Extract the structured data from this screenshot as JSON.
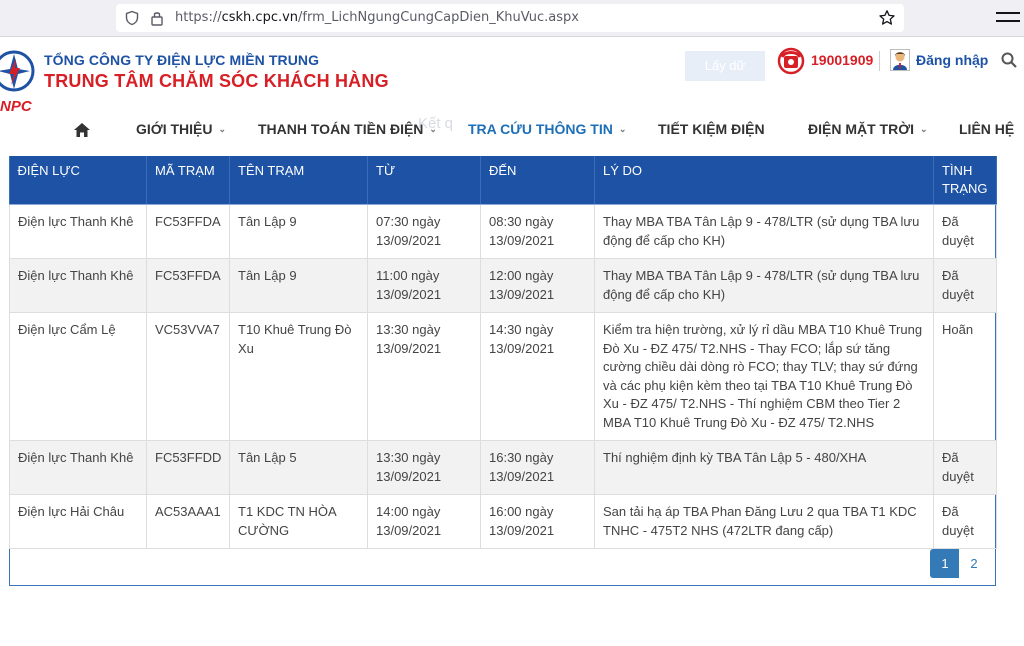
{
  "browser": {
    "url_prefix": "https://",
    "url_domain": "cskh.cpc.vn",
    "url_path": "/frm_LichNgungCungCapDien_KhuVuc.aspx"
  },
  "header": {
    "logo_text": "NPC",
    "company_line1": "TỔNG CÔNG TY ĐIỆN LỰC MIỀN TRUNG",
    "company_line2": "TRUNG TÂM CHĂM SÓC KHÁCH HÀNG",
    "ghost_button": "Lấy dữ",
    "hotline": "19001909",
    "login": "Đăng nhập",
    "ghost_text": "Kết q",
    "colors": {
      "brand_blue": "#1d52a5",
      "brand_red": "#d71f26"
    }
  },
  "nav": {
    "items": [
      {
        "label": "GIỚI THIỆU",
        "has_caret": true
      },
      {
        "label": "THANH TOÁN TIỀN ĐIỆN",
        "has_caret": true
      },
      {
        "label": "TRA CỨU THÔNG TIN",
        "has_caret": true,
        "active": true
      },
      {
        "label": "TIẾT KIỆM ĐIỆN",
        "has_caret": false
      },
      {
        "label": "ĐIỆN MẶT TRỜI",
        "has_caret": true
      },
      {
        "label": "LIÊN HỆ",
        "has_caret": false
      }
    ]
  },
  "table": {
    "headers": [
      "ĐIỆN LỰC",
      "MÃ TRẠM",
      "TÊN TRẠM",
      "TỪ",
      "ĐẾN",
      "LÝ DO",
      "TÌNH TRẠNG"
    ],
    "rows": [
      [
        "Điện lực Thanh Khê",
        "FC53FFDA",
        "Tân Lập 9",
        "07:30 ngày 13/09/2021",
        "08:30 ngày 13/09/2021",
        "Thay MBA TBA Tân Lập 9 - 478/LTR (sử dụng TBA lưu động để cấp cho KH)",
        "Đã duyệt"
      ],
      [
        "Điện lực Thanh Khê",
        "FC53FFDA",
        "Tân Lập 9",
        "11:00 ngày 13/09/2021",
        "12:00 ngày 13/09/2021",
        "Thay MBA TBA Tân Lập 9 - 478/LTR (sử dụng TBA lưu động để cấp cho KH)",
        "Đã duyệt"
      ],
      [
        "Điện lực Cẩm Lệ",
        "VC53VVA7",
        "T10 Khuê Trung Đò Xu",
        "13:30 ngày 13/09/2021",
        "14:30 ngày 13/09/2021",
        "Kiểm tra hiện trường, xử lý rỉ dầu MBA T10 Khuê Trung Đò Xu - ĐZ 475/ T2.NHS - Thay FCO; lắp sứ tăng cường chiều dài dòng rò FCO; thay TLV; thay sứ đứng và các phụ kiện kèm theo tại TBA T10 Khuê Trung Đò Xu - ĐZ 475/ T2.NHS - Thí nghiệm CBM theo Tier 2 MBA T10 Khuê Trung Đò Xu - ĐZ 475/ T2.NHS",
        "Hoãn"
      ],
      [
        "Điện lực Thanh Khê",
        "FC53FFDD",
        "Tân Lập 5",
        "13:30 ngày 13/09/2021",
        "16:30 ngày 13/09/2021",
        "Thí nghiệm định kỳ TBA Tân Lập 5 - 480/XHA",
        "Đã duyệt"
      ],
      [
        "Điện lực Hải Châu",
        "AC53AAA1",
        "T1 KDC TN HÒA CƯỜNG",
        "14:00 ngày 13/09/2021",
        "16:00 ngày 13/09/2021",
        "San tải hạ áp TBA Phan Đăng Lưu 2 qua TBA T1 KDC TNHC - 475T2 NHS (472LTR đang cấp)",
        "Đã duyệt"
      ]
    ]
  },
  "pager": {
    "current": "1",
    "other": "2"
  }
}
